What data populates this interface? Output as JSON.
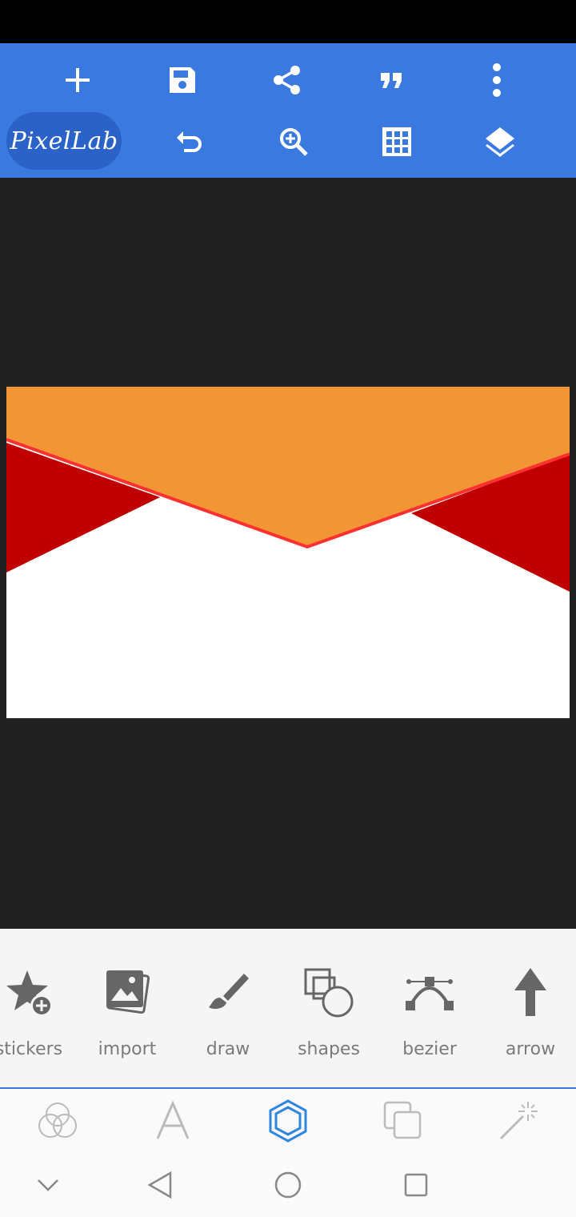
{
  "app": {
    "logo_text": "PixelLab"
  },
  "toolbar": {
    "row1": [
      {
        "name": "add-button",
        "icon": "plus-icon"
      },
      {
        "name": "save-button",
        "icon": "save-icon"
      },
      {
        "name": "share-button",
        "icon": "share-icon"
      },
      {
        "name": "quote-button",
        "icon": "quote-icon"
      },
      {
        "name": "more-button",
        "icon": "more-vert-icon"
      }
    ],
    "row2": [
      {
        "name": "undo-button",
        "icon": "undo-icon"
      },
      {
        "name": "zoom-button",
        "icon": "zoom-in-icon"
      },
      {
        "name": "grid-button",
        "icon": "grid-icon"
      },
      {
        "name": "layers-button",
        "icon": "layers-icon"
      }
    ]
  },
  "tools": [
    {
      "label": "stickers",
      "icon": "star-add-icon"
    },
    {
      "label": "import",
      "icon": "image-icon"
    },
    {
      "label": "draw",
      "icon": "brush-icon"
    },
    {
      "label": "shapes",
      "icon": "shapes-icon"
    },
    {
      "label": "bezier",
      "icon": "bezier-icon"
    },
    {
      "label": "arrow",
      "icon": "arrow-up-icon"
    }
  ],
  "modes": [
    {
      "name": "effects",
      "icon": "circles-icon",
      "active": false
    },
    {
      "name": "text",
      "icon": "text-icon",
      "active": false
    },
    {
      "name": "shape",
      "icon": "hexagon-icon",
      "active": true
    },
    {
      "name": "layers-copy",
      "icon": "copy-icon",
      "active": false
    },
    {
      "name": "magic",
      "icon": "magic-wand-icon",
      "active": false
    }
  ],
  "colors": {
    "toolbar": "#3a7ae0",
    "canvas_bg": "#212121",
    "orange": "#f29534",
    "red": "#c00000",
    "red_stroke": "#ff3030",
    "active_mode": "#2f86e0"
  }
}
